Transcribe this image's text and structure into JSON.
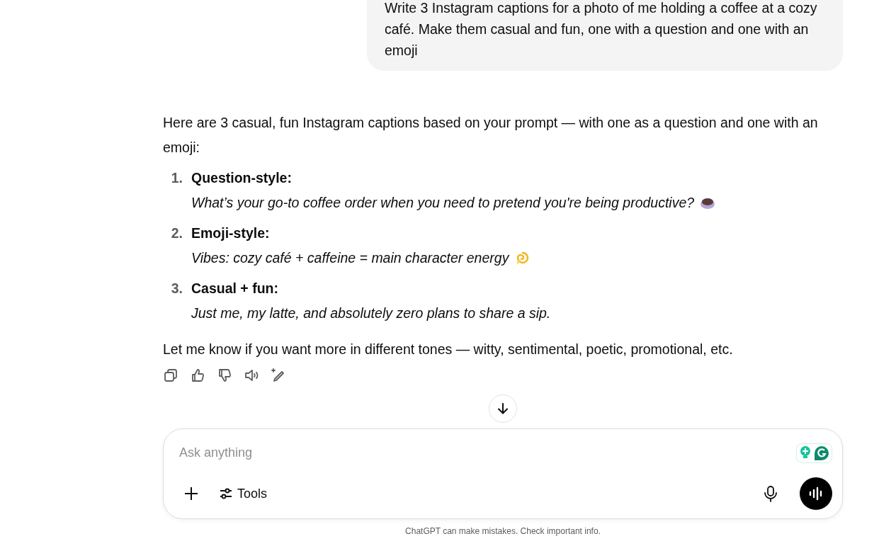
{
  "user_message": {
    "text": "Write 3 Instagram captions for a photo of me holding a coffee at a cozy café. Make them casual and fun, one with a question and one with an emoji"
  },
  "assistant_message": {
    "intro": "Here are 3 casual, fun Instagram captions based on your prompt — with one as a question and one with an emoji:",
    "items": [
      {
        "number": "1.",
        "title": "Question-style:",
        "caption": "What’s your go-to coffee order when you need to pretend you're being productive?",
        "kind": "with-cup"
      },
      {
        "number": "2.",
        "title": "Emoji-style:",
        "caption": "Vibes: cozy café + caffeine = main character energy",
        "kind": "with-swirl"
      },
      {
        "number": "3.",
        "title": "Casual + fun:",
        "caption": "Just me, my latte, and absolutely zero plans to share a sip.",
        "kind": "plain"
      }
    ],
    "outro": "Let me know if you want more in different tones — witty, sentimental, poetic, promotional, etc."
  },
  "composer": {
    "placeholder": "Ask anything",
    "tools_label": "Tools"
  },
  "footer": "ChatGPT can make mistakes. Check important info."
}
